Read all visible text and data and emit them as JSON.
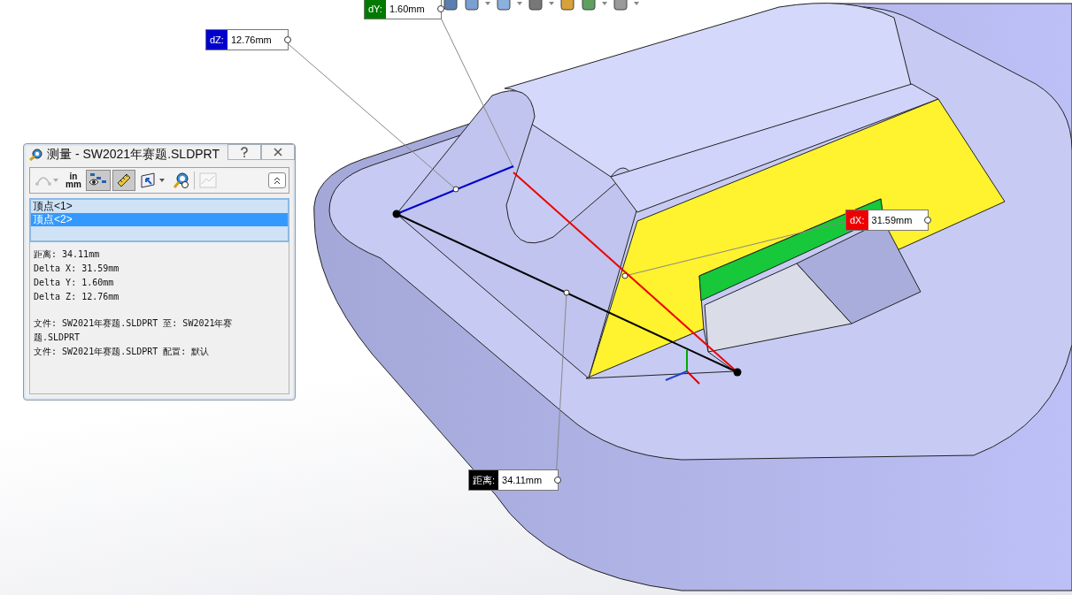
{
  "dialog": {
    "title": "测量 - SW2021年赛题.SLDPRT",
    "toolbar": [
      {
        "kind": "arc",
        "disabled": true,
        "dropdown": true,
        "selected": false
      },
      {
        "kind": "units",
        "top": "in",
        "bottom": "mm",
        "disabled": false,
        "dropdown": false,
        "selected": false
      },
      {
        "kind": "xyz",
        "disabled": false,
        "dropdown": false,
        "selected": true
      },
      {
        "kind": "ruler",
        "disabled": false,
        "dropdown": false,
        "selected": true
      },
      {
        "kind": "projection",
        "disabled": false,
        "dropdown": true,
        "selected": false
      },
      {
        "kind": "history",
        "disabled": false,
        "dropdown": false,
        "selected": false
      },
      {
        "kind": "sensor",
        "disabled": true,
        "dropdown": false,
        "selected": false
      }
    ],
    "selections": [
      {
        "label": "顶点<1>",
        "selected": false
      },
      {
        "label": "顶点<2>",
        "selected": true
      }
    ],
    "results": [
      "距离: 34.11mm",
      "Delta X: 31.59mm",
      "Delta Y: 1.60mm",
      "Delta Z: 12.76mm"
    ],
    "files": [
      "文件:  SW2021年赛题.SLDPRT 至:  SW2021年赛题.SLDPRT",
      "文件:  SW2021年赛题.SLDPRT 配置:  默认"
    ]
  },
  "callouts": [
    {
      "label": "dZ:",
      "value": "12.76mm",
      "color": "#0000cc"
    },
    {
      "label": "dY:",
      "value": "1.60mm",
      "color": "#007a00"
    },
    {
      "label": "dX:",
      "value": "31.59mm",
      "color": "#ee0000"
    },
    {
      "label": "距离:",
      "value": "34.11mm",
      "color": "#000000"
    }
  ]
}
